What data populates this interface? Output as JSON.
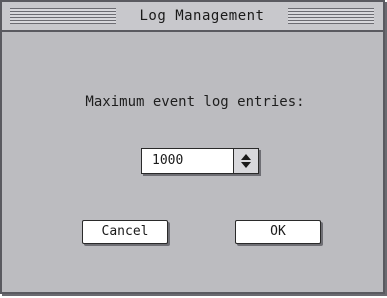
{
  "window": {
    "title": "Log Management"
  },
  "dialog": {
    "prompt": "Maximum event log entries:",
    "entries_select": {
      "value": "1000",
      "icon": "up-down-arrows-icon"
    },
    "buttons": {
      "cancel_label": "Cancel",
      "ok_label": "OK"
    }
  },
  "colors": {
    "window_bg": "#bcbcc0",
    "border": "#5a5a60",
    "field_bg": "#ffffff"
  }
}
